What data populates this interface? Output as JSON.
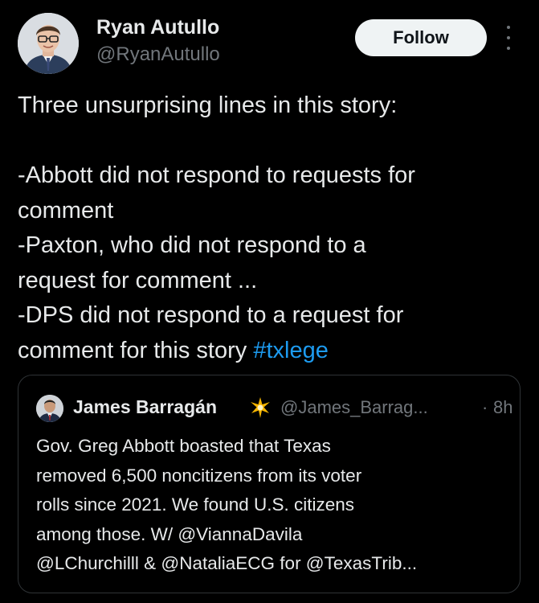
{
  "author": {
    "display_name": "Ryan Autullo",
    "handle": "@RyanAutullo"
  },
  "actions": {
    "follow_label": "Follow",
    "more_icon": "more-vertical-icon"
  },
  "tweet": {
    "lines": [
      "Three unsurprising lines in this story:",
      "",
      "-Abbott did not respond to requests for",
      "comment",
      "-Paxton, who did not respond to a",
      "request for comment ...",
      "-DPS did not respond to a request for",
      "comment for this story "
    ],
    "hashtag": "#txlege"
  },
  "quote": {
    "display_name": "James Barragán",
    "badge_icon": "sparkle-icon",
    "handle": "@James_Barrag...",
    "separator": "·",
    "time": "8h",
    "lines": [
      "Gov. Greg Abbott boasted that Texas",
      "removed 6,500 noncitizens from its voter",
      "rolls since 2021. We found U.S. citizens",
      "among those. W/ ",
      " & ",
      " for @TexasTrib..."
    ],
    "mentions": [
      "@ViannaDavila",
      "@LChurchilll",
      "@NataliaECG"
    ]
  },
  "colors": {
    "background": "#000000",
    "text_primary": "#e7e9ea",
    "text_secondary": "#71767b",
    "link": "#1d9bf0",
    "follow_bg": "#eff3f4",
    "border": "#2f3336"
  }
}
